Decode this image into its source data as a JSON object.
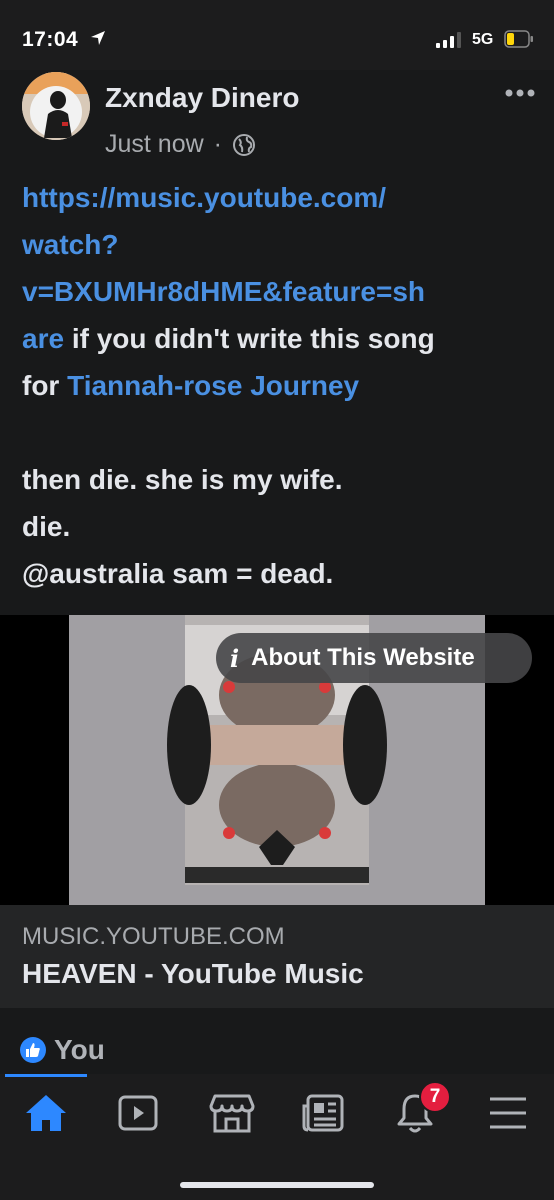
{
  "status_bar": {
    "time": "17:04",
    "network": "5G"
  },
  "post": {
    "author": "Zxnday Dinero",
    "timestamp": "Just now",
    "separator": "·",
    "text_lines": [
      {
        "link": "https://music.youtube.com/",
        "text": ""
      },
      {
        "link": "watch?",
        "text": ""
      },
      {
        "link": "v=BXUMHr8dHME&feature=sh",
        "text": ""
      },
      {
        "link": "are",
        "text": " if you didn't write this song"
      },
      {
        "prefix": "for ",
        "link": "Tiannah-rose Journey",
        "text": ""
      }
    ],
    "body_lines": [
      "then die. she is my wife.",
      "die.",
      "@australia sam = dead."
    ]
  },
  "link_preview": {
    "about_label": "About This Website",
    "domain": "MUSIC.YOUTUBE.COM",
    "title": "HEAVEN - YouTube Music"
  },
  "reactions": {
    "label": "You"
  },
  "tab_bar": {
    "notification_count": "7",
    "tabs": [
      "home-icon",
      "video-icon",
      "marketplace-icon",
      "news-icon",
      "bell-icon",
      "menu-icon"
    ]
  },
  "colors": {
    "link": "#4a90e2",
    "accent": "#2d88ff",
    "badge": "#e41e3f",
    "background": "#18191a"
  }
}
